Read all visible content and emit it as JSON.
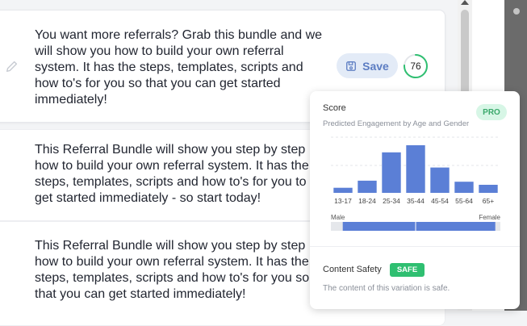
{
  "cards": [
    {
      "lines": [
        "You want more referrals? Grab this bundle and we",
        "will show you how to build your own referral",
        "system. It has the steps, templates, scripts and",
        "how to's for you so that you can get started",
        "immediately!"
      ]
    },
    {
      "lines": [
        "This Referral Bundle will show you step by step",
        "how to build your own referral system. It has the",
        "steps, templates, scripts and how to's for you to",
        "get started immediately - so start today!"
      ]
    },
    {
      "lines": [
        "This Referral Bundle will show you step by step",
        "how to build your own referral system. It has the",
        "steps, templates, scripts and how to's for you so",
        "that you can get started immediately!"
      ]
    }
  ],
  "save_button": {
    "label": "Save"
  },
  "score": {
    "value": "76",
    "fraction": 0.76,
    "color": "#2fbf71"
  },
  "panel": {
    "title": "Score",
    "badge": "PRO",
    "subtitle": "Predicted Engagement by Age and Gender",
    "safety_label": "Content Safety",
    "safety_badge": "SAFE",
    "safety_text": "The content of this variation is safe."
  },
  "chart_data": {
    "type": "bar",
    "categories": [
      "13-17",
      "18-24",
      "25-34",
      "35-44",
      "45-54",
      "55-64",
      "65+"
    ],
    "values": [
      5,
      12,
      40,
      47,
      25,
      11,
      8
    ],
    "ylim": [
      0,
      55
    ],
    "bar_color": "#5b7fd6",
    "gender": {
      "left_label": "Male",
      "right_label": "Female",
      "male_fraction": 0.43,
      "female_fraction": 0.47
    }
  }
}
